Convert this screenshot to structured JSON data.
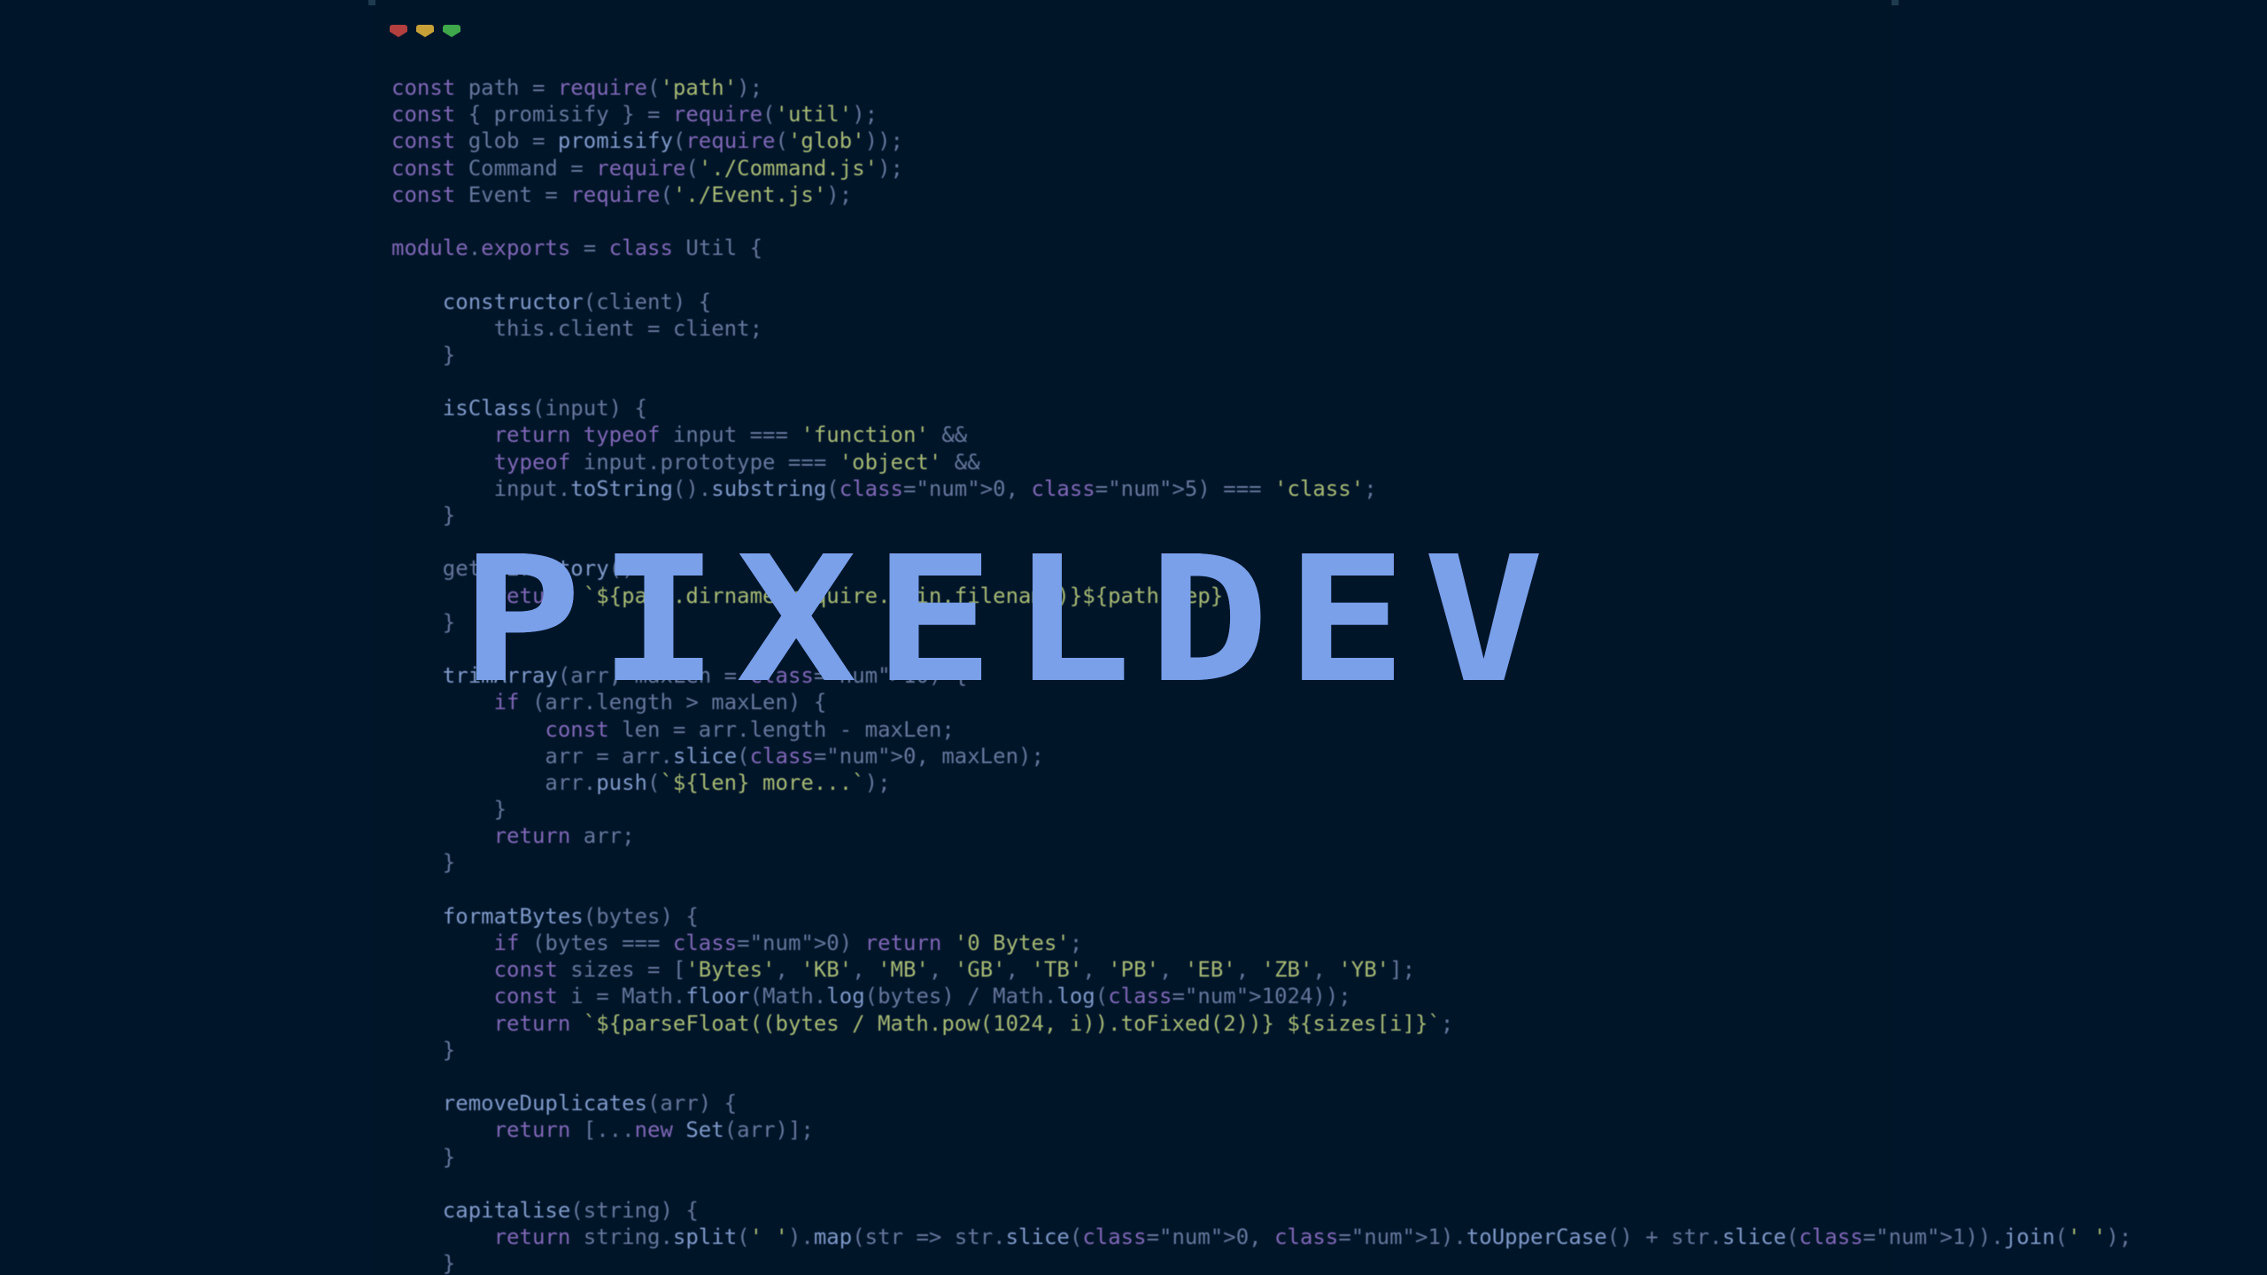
{
  "window": {
    "controls": [
      "close",
      "minimize",
      "maximize"
    ]
  },
  "logo": {
    "text": "PIXELDEV",
    "color": "#7aa0ea"
  },
  "code_lines": [
    "const path = require('path');",
    "const { promisify } = require('util');",
    "const glob = promisify(require('glob'));",
    "const Command = require('./Command.js');",
    "const Event = require('./Event.js');",
    "",
    "module.exports = class Util {",
    "",
    "    constructor(client) {",
    "        this.client = client;",
    "    }",
    "",
    "    isClass(input) {",
    "        return typeof input === 'function' &&",
    "        typeof input.prototype === 'object' &&",
    "        input.toString().substring(0, 5) === 'class';",
    "    }",
    "",
    "    get directory() {",
    "        return `${path.dirname(require.main.filename)}${path.sep}`;",
    "    }",
    "",
    "    trimArray(arr, maxLen = 10) {",
    "        if (arr.length > maxLen) {",
    "            const len = arr.length - maxLen;",
    "            arr = arr.slice(0, maxLen);",
    "            arr.push(`${len} more...`);",
    "        }",
    "        return arr;",
    "    }",
    "",
    "    formatBytes(bytes) {",
    "        if (bytes === 0) return '0 Bytes';",
    "        const sizes = ['Bytes', 'KB', 'MB', 'GB', 'TB', 'PB', 'EB', 'ZB', 'YB'];",
    "        const i = Math.floor(Math.log(bytes) / Math.log(1024));",
    "        return `${parseFloat((bytes / Math.pow(1024, i)).toFixed(2))} ${sizes[i]}`;",
    "    }",
    "",
    "    removeDuplicates(arr) {",
    "        return [...new Set(arr)];",
    "    }",
    "",
    "    capitalise(string) {",
    "        return string.split(' ').map(str => str.slice(0, 1).toUpperCase() + str.slice(1)).join(' ');",
    "    }"
  ]
}
